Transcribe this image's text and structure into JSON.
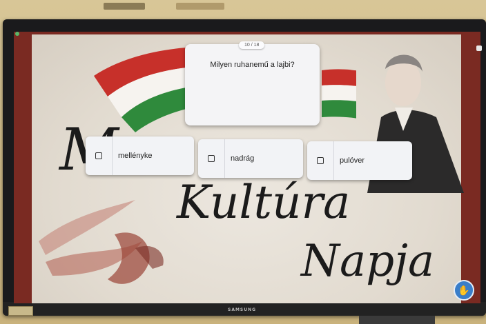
{
  "quiz": {
    "counter": "10 / 18",
    "question": "Milyen ruhanemű a lajbi?",
    "answers": [
      {
        "label": "mellényke"
      },
      {
        "label": "nadrág"
      },
      {
        "label": "pulóver"
      }
    ]
  },
  "background": {
    "letter": "M",
    "word1": "Kultúra",
    "word2": "Napja",
    "flag_colors": [
      "#d12a2a",
      "#ffffff",
      "#2e8b3a"
    ]
  },
  "device": {
    "brand": "SAMSUNG"
  },
  "icons": {
    "help": "raised-hand-icon"
  }
}
